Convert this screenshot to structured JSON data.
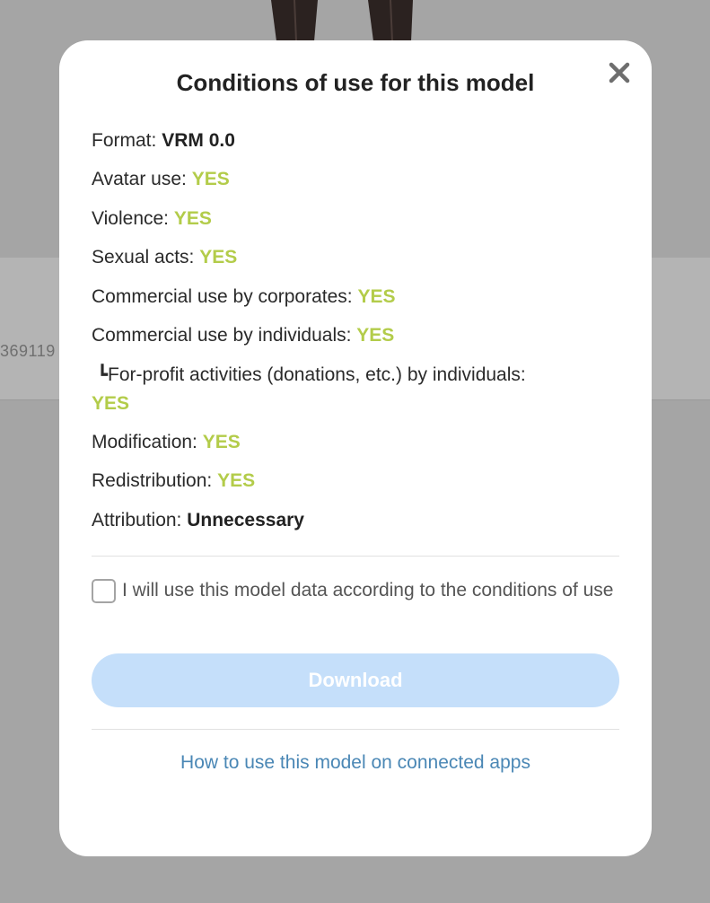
{
  "background": {
    "partial_number": "369119"
  },
  "modal": {
    "title": "Conditions of use for this model",
    "close_icon": "close-icon",
    "conditions": [
      {
        "label": "Format: ",
        "value": "VRM 0.0",
        "style": "strong"
      },
      {
        "label": "Avatar use: ",
        "value": "YES",
        "style": "yes"
      },
      {
        "label": "Violence: ",
        "value": "YES",
        "style": "yes"
      },
      {
        "label": "Sexual acts: ",
        "value": "YES",
        "style": "yes"
      },
      {
        "label": "Commercial use by corporates: ",
        "value": "YES",
        "style": "yes"
      },
      {
        "label": "Commercial use by individuals: ",
        "value": "YES",
        "style": "yes"
      },
      {
        "marker": "┗",
        "label": "For-profit activities (donations, etc.) by individuals:",
        "value": "YES",
        "style": "yes"
      },
      {
        "label": "Modification: ",
        "value": "YES",
        "style": "yes"
      },
      {
        "label": "Redistribution: ",
        "value": "YES",
        "style": "yes"
      },
      {
        "label": "Attribution: ",
        "value": "Unnecessary",
        "style": "strong"
      }
    ],
    "agreement": {
      "checked": false,
      "label": "I will use this model data according to the conditions of use"
    },
    "download_label": "Download",
    "help_link": "How to use this model on connected apps"
  },
  "colors": {
    "yes": "#b3cc4a",
    "link": "#4a87b5",
    "download_disabled": "#c5dffa",
    "overlay": "#a5a5a5"
  }
}
